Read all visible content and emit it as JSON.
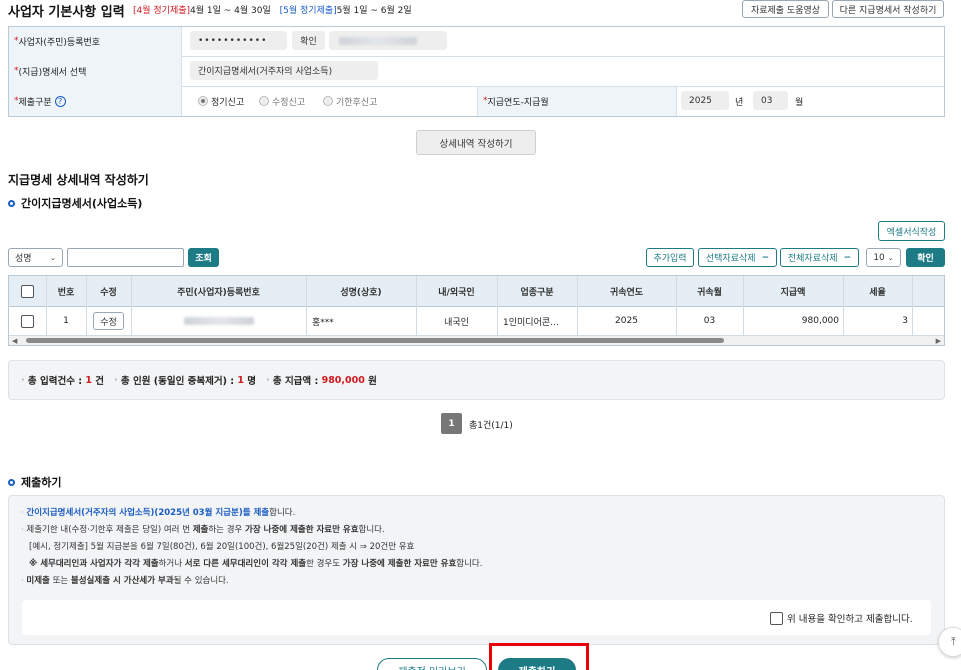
{
  "header": {
    "title": "사업자 기본사항 입력",
    "period1_tag": "[4월 정기제출]",
    "period1_range": "4월 1일 ~ 4월 30일",
    "period2_tag": "[5월 정기제출]",
    "period2_range": "5월 1일 ~ 6월 2일",
    "help_video_button": "자료제출 도움영상",
    "other_statement_button": "다른 지급명세서 작성하기"
  },
  "form": {
    "reg_no_label": "사업자(주민)등록번호",
    "reg_no_value": "•••••••••••",
    "confirm_button": "확인",
    "statement_label": "(지급)명세서 선택",
    "statement_value": "간이지급명세서(거주자의 사업소득)",
    "submit_type_label": "제출구분",
    "radio_regular": "정기신고",
    "radio_amend": "수정신고",
    "radio_late": "기한후신고",
    "pay_year_label": "지급연도-지급월",
    "year_value": "2025",
    "year_unit": "년",
    "month_value": "03",
    "month_unit": "월",
    "detail_button": "상세내역 작성하기",
    "required_mark": "*"
  },
  "detail": {
    "heading": "지급명세 상세내역 작성하기",
    "subheading": "간이지급명세서(사업소득)",
    "excel_button": "엑셀서식작성",
    "search_select": "성명",
    "search_placeholder": "",
    "search_button": "조회",
    "add_button": "추가입력",
    "delete_selected_button": "선택자료삭제",
    "delete_all_button": "전체자료삭제",
    "page_size": "10",
    "confirm_button": "확인",
    "columns": [
      "번호",
      "수정",
      "주민(사업자)등록번호",
      "성명(상호)",
      "내/외국인",
      "업종구분",
      "귀속연도",
      "귀속월",
      "지급액",
      "세율"
    ],
    "rows": [
      {
        "no": "1",
        "edit": "수정",
        "name": "홍***",
        "nationality": "내국인",
        "industry": "1인미디어콘…",
        "year": "2025",
        "month": "03",
        "amount": "980,000",
        "rate": "3"
      }
    ]
  },
  "summary": {
    "count_label": "총 입력건수 :",
    "count_value": "1",
    "count_unit": "건",
    "people_label": "총 인원 (동일인 중복제거) :",
    "people_value": "1",
    "people_unit": "명",
    "amount_label": "총 지급액 :",
    "amount_value": "980,000",
    "amount_unit": "원"
  },
  "pagination": {
    "current": "1",
    "info": "총1건(1/1)"
  },
  "submit_section": {
    "heading": "제출하기",
    "notice1_blue": "간이지급명세서(거주자의 사업소득)(2025년 03월 지급분)를 제출",
    "notice1_rest": "합니다.",
    "notice2_a": "제출기한 내(수정·기한후 제출은 당일) 여러 번 ",
    "notice2_b": "제출",
    "notice2_c": "하는 경우 ",
    "notice2_d": "가장 나중에 제출한 자료만 유효",
    "notice2_e": "합니다.",
    "notice3": "[예시, 정기제출] 5월 지급분을 6월 7일(80건), 6월 20일(100건), 6월25일(20건) 제출 시 ⇒ 20건만 유효",
    "notice4_a": "※ 세무대리인과 사업자가 각각 제출",
    "notice4_b": "하거나 ",
    "notice4_c": "서로 다른 세무대리인이 각각 제출",
    "notice4_d": "한 경우도 ",
    "notice4_e": "가장 나중에 제출한 자료만 유효",
    "notice4_f": "합니다.",
    "notice5_a": "미제출",
    "notice5_b": " 또는 ",
    "notice5_c": "불성실제출 시 가산세가 부과",
    "notice5_d": "될 수 있습니다.",
    "agree_label": "위 내용을 확인하고 제출합니다.",
    "preview_button": "제출전 미리보기",
    "submit_button": "제출하기"
  },
  "colors": {
    "accent_teal": "#1d7b86",
    "required_red": "#d0191f",
    "highlight_box": "#e8000b",
    "link_blue": "#1a5bc4"
  }
}
